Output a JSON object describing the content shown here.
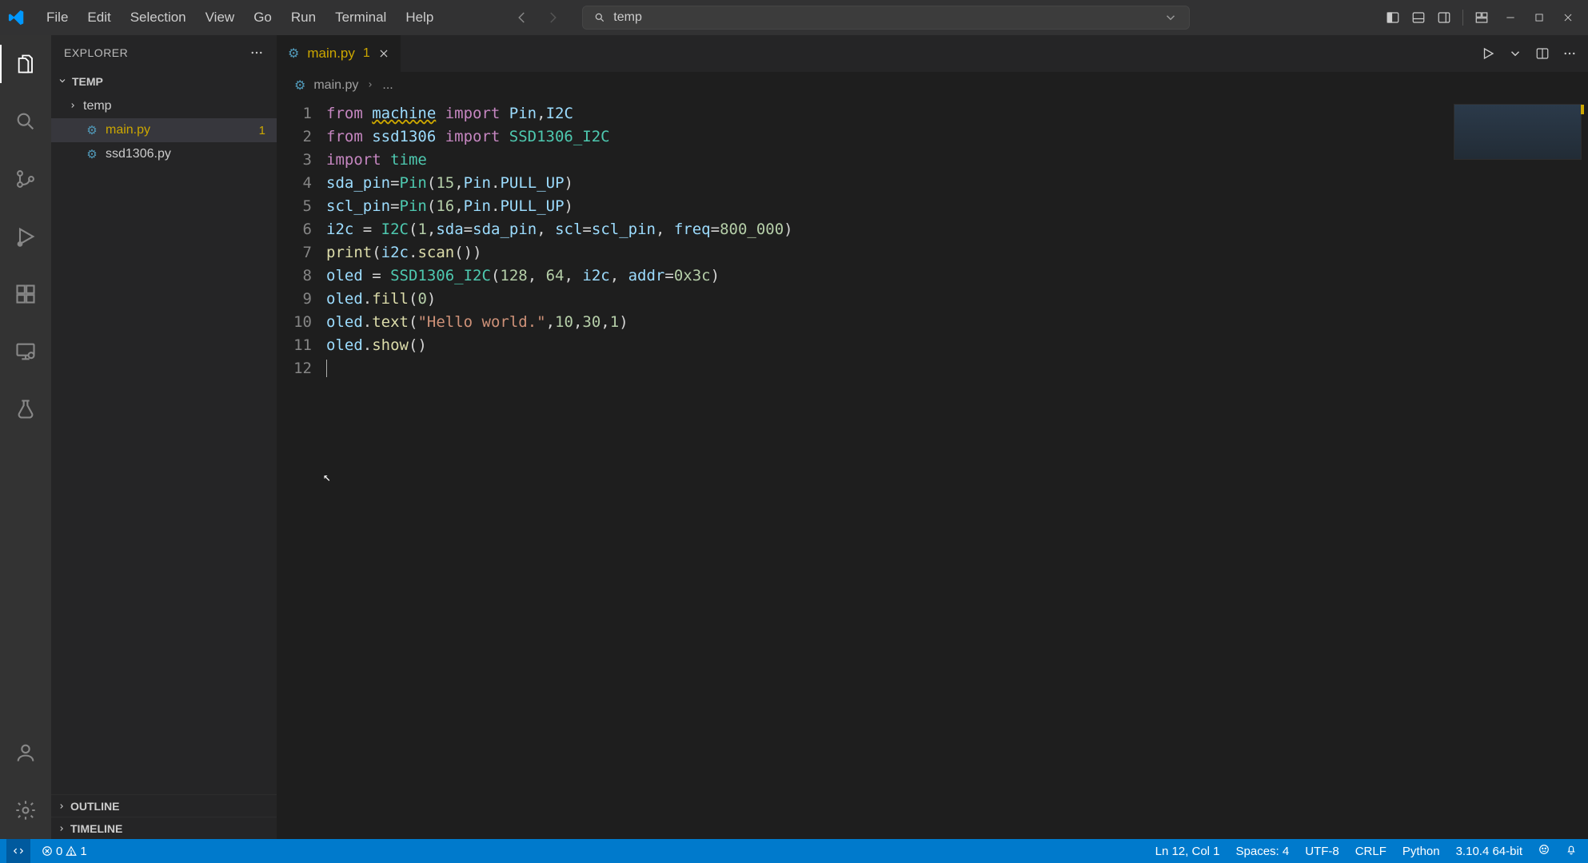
{
  "menu": {
    "items": [
      "File",
      "Edit",
      "Selection",
      "View",
      "Go",
      "Run",
      "Terminal",
      "Help"
    ]
  },
  "search": {
    "text": "temp"
  },
  "sidebar": {
    "title": "EXPLORER",
    "section": "TEMP",
    "tree": {
      "folder": "temp",
      "files": [
        {
          "name": "main.py",
          "badge": "1",
          "warn": true,
          "selected": true
        },
        {
          "name": "ssd1306.py",
          "badge": "",
          "warn": false,
          "selected": false
        }
      ]
    },
    "outline": "OUTLINE",
    "timeline": "TIMELINE"
  },
  "tab": {
    "name": "main.py",
    "badge": "1"
  },
  "breadcrumb": {
    "file": "main.py",
    "more": "..."
  },
  "code": {
    "total_lines": 12,
    "l1": {
      "a": "from ",
      "b": "machine",
      "c": " import ",
      "d": "Pin",
      "e": ",",
      "f": "I2C"
    },
    "l2": {
      "a": "from ",
      "b": "ssd1306",
      "c": " import ",
      "d": "SSD1306_I2C"
    },
    "l3": {
      "a": "import ",
      "b": "time"
    },
    "l4": {
      "a": "sda_pin",
      "b": "=",
      "c": "Pin",
      "d": "(",
      "e": "15",
      "f": ",",
      "g": "Pin",
      "h": ".",
      "i": "PULL_UP",
      "j": ")"
    },
    "l5": {
      "a": "scl_pin",
      "b": "=",
      "c": "Pin",
      "d": "(",
      "e": "16",
      "f": ",",
      "g": "Pin",
      "h": ".",
      "i": "PULL_UP",
      "j": ")"
    },
    "l6": {
      "a": "i2c ",
      "b": "= ",
      "c": "I2C",
      "d": "(",
      "e": "1",
      "f": ",",
      "g": "sda",
      "h": "=",
      "i": "sda_pin",
      "j": ", ",
      "k": "scl",
      "l": "=",
      "m": "scl_pin",
      "n": ", ",
      "o": "freq",
      "p": "=",
      "q": "800_000",
      "r": ")"
    },
    "l7": {
      "a": "print",
      "b": "(",
      "c": "i2c",
      "d": ".",
      "e": "scan",
      "f": "())"
    },
    "l8": {
      "a": "oled ",
      "b": "= ",
      "c": "SSD1306_I2C",
      "d": "(",
      "e": "128",
      "f": ", ",
      "g": "64",
      "h": ", ",
      "i": "i2c",
      "j": ", ",
      "k": "addr",
      "l": "=",
      "m": "0x3c",
      "n": ")"
    },
    "l9": {
      "a": "oled",
      "b": ".",
      "c": "fill",
      "d": "(",
      "e": "0",
      "f": ")"
    },
    "l10": {
      "a": "oled",
      "b": ".",
      "c": "text",
      "d": "(",
      "e": "\"Hello world.\"",
      "f": ",",
      "g": "10",
      "h": ",",
      "i": "30",
      "j": ",",
      "k": "1",
      "l": ")"
    },
    "l11": {
      "a": "oled",
      "b": ".",
      "c": "show",
      "d": "()"
    }
  },
  "status": {
    "errors": "0",
    "warnings": "1",
    "cursor": "Ln 12, Col 1",
    "spaces": "Spaces: 4",
    "encoding": "UTF-8",
    "eol": "CRLF",
    "lang": "Python",
    "interp": "3.10.4 64-bit"
  }
}
